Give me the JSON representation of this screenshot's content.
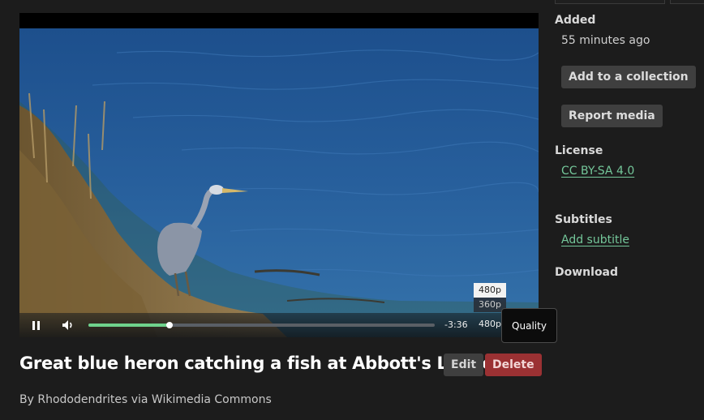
{
  "video": {
    "playback_state": "playing",
    "time_remaining": "-3:36",
    "progress_fraction": 0.235,
    "quality_current": "480p",
    "quality_options": [
      "480p",
      "360p"
    ],
    "quality_tooltip": "Quality",
    "pause_icon": "pause-icon",
    "volume_icon": "volume-icon"
  },
  "media": {
    "title": "Great blue heron catching a fish at Abbott's Lagoon",
    "byline": "By Rhododendrites via Wikimedia Commons",
    "edit_label": "Edit",
    "delete_label": "Delete"
  },
  "sidebar": {
    "added_heading": "Added",
    "added_value": "55 minutes ago",
    "add_collection_label": "Add to a collection",
    "report_label": "Report media",
    "license_heading": "License",
    "license_link": "CC BY-SA 4.0",
    "subtitles_heading": "Subtitles",
    "add_subtitle_link": "Add subtitle",
    "download_heading": "Download"
  },
  "colors": {
    "accent_green": "#74c79a",
    "progress_green": "#6fd28c",
    "delete_red": "#9b3133",
    "background": "#1c1c1c"
  }
}
